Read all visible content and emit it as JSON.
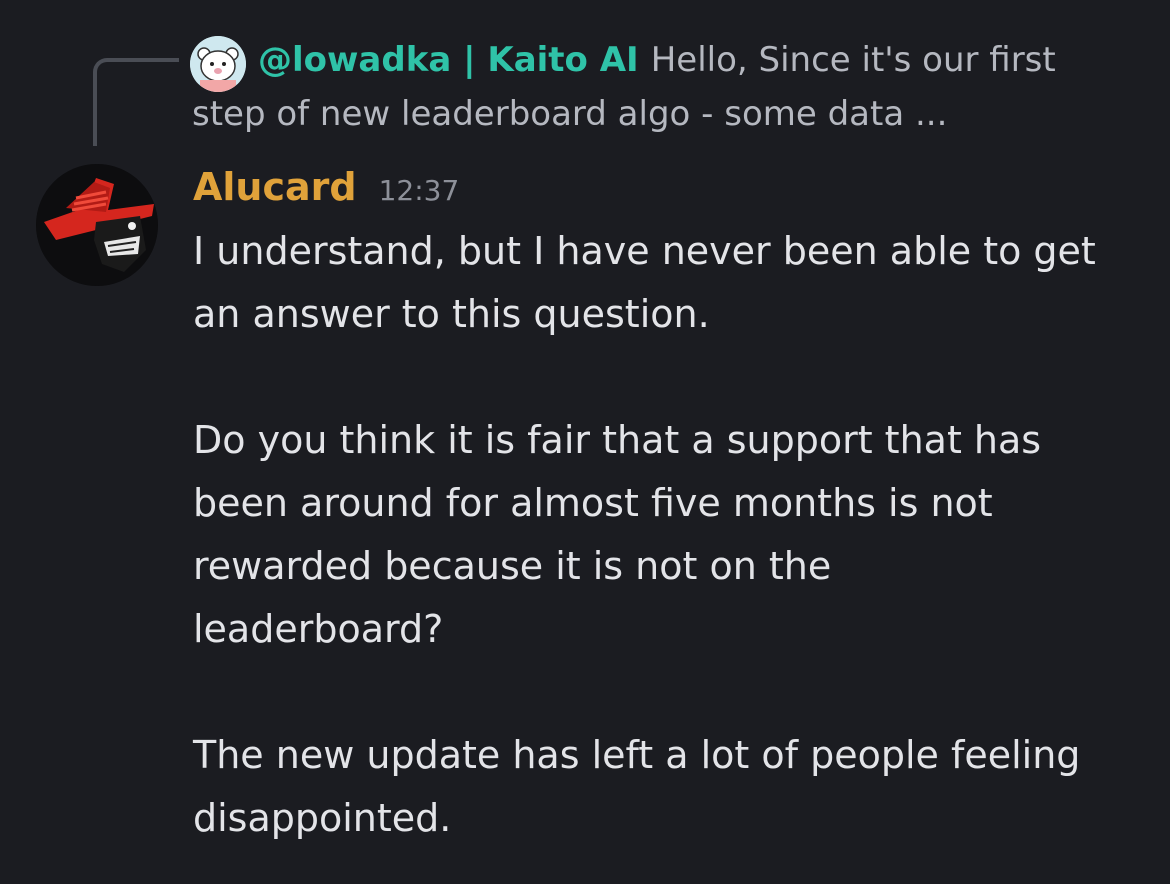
{
  "reply": {
    "author": "@lowadka | Kaito AI",
    "preview_line1": "Hello,  Since it's our first",
    "preview_line2": "step of new leaderboard algo - some data ..."
  },
  "message": {
    "author": "Alucard",
    "timestamp": "12:37",
    "author_color": "#e0a23a",
    "paragraphs": {
      "p1_line1": "I understand, but I have never been able to get",
      "p1_line2": "an answer to this question.",
      "p2_line1": "Do you think it is fair that a support that has",
      "p2_line2": "been around for almost five months is not",
      "p2_line3": "rewarded because it is not on the",
      "p2_line4": "leaderboard?",
      "p3_line1": "The new update has left a lot of people feeling",
      "p3_line2": "disappointed."
    }
  },
  "colors": {
    "background": "#1b1c21",
    "reply_author": "#2fc3a8",
    "text": "#e3e4e8",
    "muted": "#b5b8c0"
  },
  "icons": {
    "reply_avatar": "polar-bear-avatar-icon",
    "author_avatar": "red-hat-character-avatar-icon"
  }
}
